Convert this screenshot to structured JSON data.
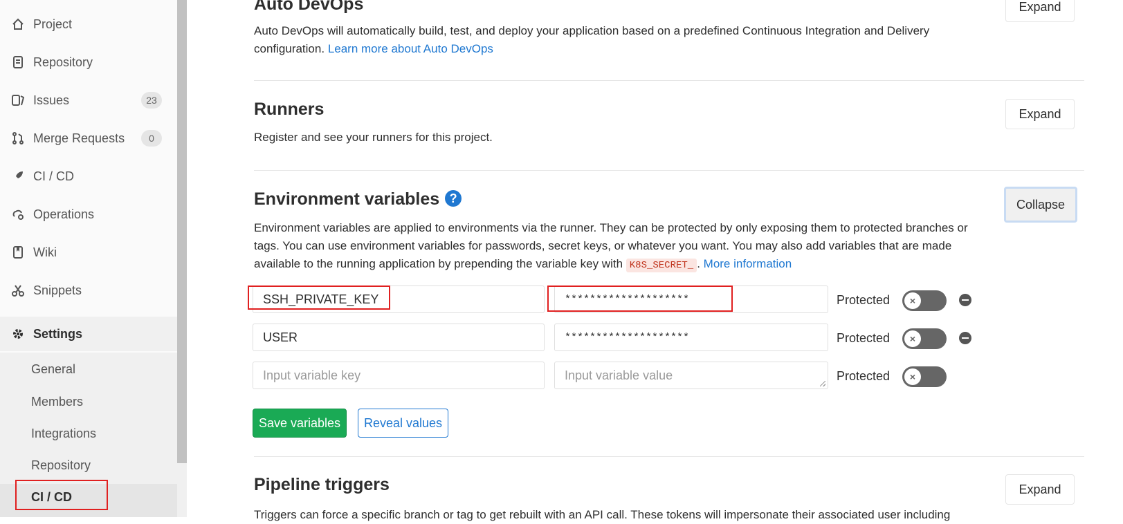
{
  "sidebar": {
    "items": [
      {
        "label": "Project",
        "icon": "home-icon"
      },
      {
        "label": "Repository",
        "icon": "doc-icon"
      },
      {
        "label": "Issues",
        "icon": "issues-icon",
        "badge": "23"
      },
      {
        "label": "Merge Requests",
        "icon": "merge-request-icon",
        "badge": "0"
      },
      {
        "label": "CI / CD",
        "icon": "rocket-icon"
      },
      {
        "label": "Operations",
        "icon": "cloud-gear-icon"
      },
      {
        "label": "Wiki",
        "icon": "book-icon"
      },
      {
        "label": "Snippets",
        "icon": "scissors-icon"
      },
      {
        "label": "Settings",
        "icon": "gear-icon"
      }
    ],
    "settings_sub": [
      "General",
      "Members",
      "Integrations",
      "Repository",
      "CI / CD"
    ]
  },
  "sections": {
    "auto_devops": {
      "title": "Auto DevOps",
      "desc": "Auto DevOps will automatically build, test, and deploy your application based on a predefined Continuous Integration and Delivery configuration.",
      "link": "Learn more about Auto DevOps",
      "button": "Expand"
    },
    "runners": {
      "title": "Runners",
      "desc": "Register and see your runners for this project.",
      "button": "Expand"
    },
    "env_vars": {
      "title": "Environment variables",
      "desc_1": "Environment variables are applied to environments via the runner. They can be protected by only exposing them to protected branches or tags. You can use environment variables for passwords, secret keys, or whatever you want. You may also add variables that are made available to the running application by prepending the variable key with",
      "code": "K8S_SECRET_",
      "desc_2": ".",
      "link": "More information",
      "button": "Collapse",
      "rows": [
        {
          "key": "SSH_PRIVATE_KEY",
          "value": "********************",
          "protected_label": "Protected"
        },
        {
          "key": "USER",
          "value": "********************",
          "protected_label": "Protected"
        }
      ],
      "new_row": {
        "key_placeholder": "Input variable key",
        "value_placeholder": "Input variable value",
        "protected_label": "Protected"
      },
      "save_button": "Save variables",
      "reveal_button": "Reveal values"
    },
    "pipeline_triggers": {
      "title": "Pipeline triggers",
      "desc": "Triggers can force a specific branch or tag to get rebuilt with an API call. These tokens will impersonate their associated user including",
      "button": "Expand"
    }
  },
  "colors": {
    "accent": "#1f78d1",
    "success": "#1aaa55",
    "highlight": "#e02020"
  }
}
